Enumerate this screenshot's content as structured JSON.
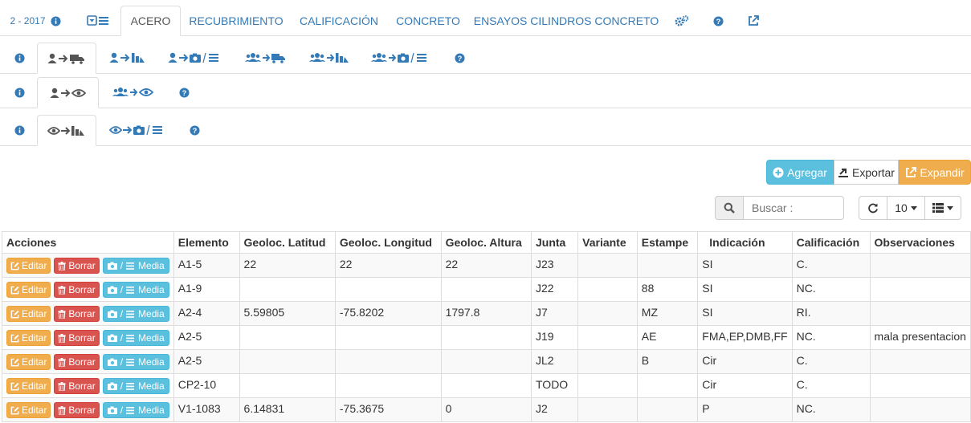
{
  "nav1": {
    "year_label": "2 - 2017",
    "tabs": [
      "ACERO",
      "RECUBRIMIENTO",
      "CALIFICACIÓN",
      "CONCRETO",
      "ENSAYOS CILINDROS CONCRETO"
    ],
    "icons": [
      "info-icon",
      "list-toggle-icon",
      "gears-icon",
      "question-icon",
      "external-link-icon"
    ]
  },
  "nav2": {
    "icons": [
      "info-icon",
      "user-to-truck-icon",
      "user-to-cubes-icon",
      "user-to-camera-list-icon",
      "users-to-truck-icon",
      "users-to-cubes-icon",
      "users-to-camera-list-icon",
      "question-icon"
    ]
  },
  "nav3": {
    "icons": [
      "info-icon",
      "user-to-eye-icon",
      "users-to-eye-icon",
      "question-icon"
    ]
  },
  "nav4": {
    "icons": [
      "info-icon",
      "eye-to-cubes-icon",
      "eye-to-camera-list-icon",
      "question-icon"
    ]
  },
  "toolbar": {
    "add_label": "Agregar",
    "export_label": "Exportar",
    "expand_label": "Expandir",
    "search_placeholder": "Buscar :",
    "page_size": "10",
    "colors": {
      "add": "#5bc0de",
      "expand": "#f0ad4e",
      "edit": "#f0ad4e",
      "delete": "#d9534f",
      "media": "#5bc0de",
      "link": "#337ab7"
    }
  },
  "table": {
    "columns": [
      "Acciones",
      "Elemento",
      "Geoloc. Latitud",
      "Geoloc. Longitud",
      "Geoloc. Altura",
      "Junta",
      "Variante",
      "Estampe",
      "Indicación",
      "Calificación",
      "Observaciones"
    ],
    "action_labels": {
      "edit": "Editar",
      "delete": "Borrar",
      "media": "Media",
      "media_sep": "/"
    },
    "rows": [
      [
        "A1-5",
        "22",
        "22",
        "22",
        "J23",
        "",
        "",
        "SI",
        "C.",
        ""
      ],
      [
        "A1-9",
        "",
        "",
        "",
        "J22",
        "",
        "88",
        "SI",
        "NC.",
        ""
      ],
      [
        "A2-4",
        "5.59805",
        "-75.8202",
        "1797.8",
        "J7",
        "",
        "MZ",
        "SI",
        "RI.",
        ""
      ],
      [
        "A2-5",
        "",
        "",
        "",
        "J19",
        "",
        "AE",
        "FMA,EP,DMB,FF",
        "NC.",
        "mala presentacion"
      ],
      [
        "A2-5",
        "",
        "",
        "",
        "JL2",
        "",
        "B",
        "Cir",
        "C.",
        ""
      ],
      [
        "CP2-10",
        "",
        "",
        "",
        "TODO",
        "",
        "",
        "Cir",
        "C.",
        ""
      ],
      [
        "V1-1083",
        "6.14831",
        "-75.3675",
        "0",
        "J2",
        "",
        "",
        "P",
        "NC.",
        ""
      ]
    ]
  }
}
